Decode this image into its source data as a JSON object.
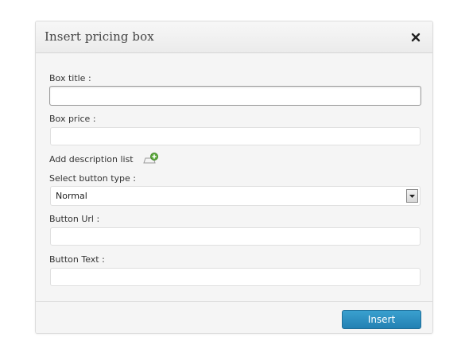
{
  "dialog": {
    "title": "Insert pricing box",
    "close_icon": "close-icon"
  },
  "form": {
    "box_title_label": "Box title :",
    "box_title_value": "",
    "box_price_label": "Box price :",
    "box_price_value": "",
    "add_description_label": "Add description list",
    "add_description_icon": "add-list-icon",
    "button_type_label": "Select button type :",
    "button_type_value": "Normal",
    "button_url_label": "Button Url :",
    "button_url_value": "",
    "button_text_label": "Button Text :",
    "button_text_value": ""
  },
  "footer": {
    "insert_label": "Insert"
  },
  "colors": {
    "primary_button": "#2a8fc2",
    "dialog_bg": "#f5f5f5"
  }
}
